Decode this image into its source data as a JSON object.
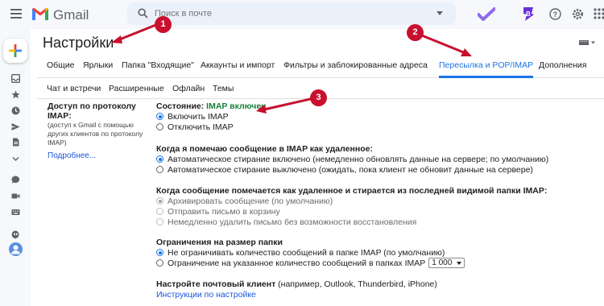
{
  "header": {
    "app_name": "Gmail",
    "search_placeholder": "Поиск в почте"
  },
  "settings": {
    "title": "Настройки",
    "tabs_row1": [
      "Общие",
      "Ярлыки",
      "Папка \"Входящие\"",
      "Аккаунты и импорт",
      "Фильтры и заблокированные адреса",
      "Пересылка и POP/IMAP",
      "Дополнения"
    ],
    "tabs_row2": [
      "Чат и встречи",
      "Расширенные",
      "Офлайн",
      "Темы"
    ],
    "active_tab": "Пересылка и POP/IMAP"
  },
  "imap": {
    "label_title": "Доступ по протоколу IMAP:",
    "label_desc": "(доступ к Gmail с помощью других клиентов по протоколу IMAP)",
    "label_link": "Подробнее...",
    "status_prefix": "Состояние:",
    "status_value": "IMAP включен",
    "enable": "Включить IMAP",
    "disable": "Отключить IMAP",
    "deleted_heading": "Когда я помечаю сообщение в IMAP как удаленное:",
    "deleted_opt1": "Автоматическое стирание включено (немедленно обновлять данные на сервере; по умолчанию)",
    "deleted_opt2": "Автоматическое стирание выключено (ожидать, пока клиент не обновит данные на сервере)",
    "expunge_heading": "Когда сообщение помечается как удаленное и стирается из последней видимой папки IMAP:",
    "expunge_opt1": "Архивировать сообщение (по умолчанию)",
    "expunge_opt2": "Отправить письмо в корзину",
    "expunge_opt3": "Немедленно удалить письмо без возможности восстановления",
    "limit_heading": "Ограничения на размер папки",
    "limit_opt1": "Не ограничивать количество сообщений в папке IMAP (по умолчанию)",
    "limit_opt2": "Ограничение на указанное количество сообщений в папках IMAP",
    "limit_value": "1 000",
    "client_heading": "Настройте почтовый клиент",
    "client_note": "(например, Outlook, Thunderbird, iPhone)",
    "client_link": "Инструкции по настройке"
  },
  "markers": [
    "1",
    "2",
    "3"
  ]
}
